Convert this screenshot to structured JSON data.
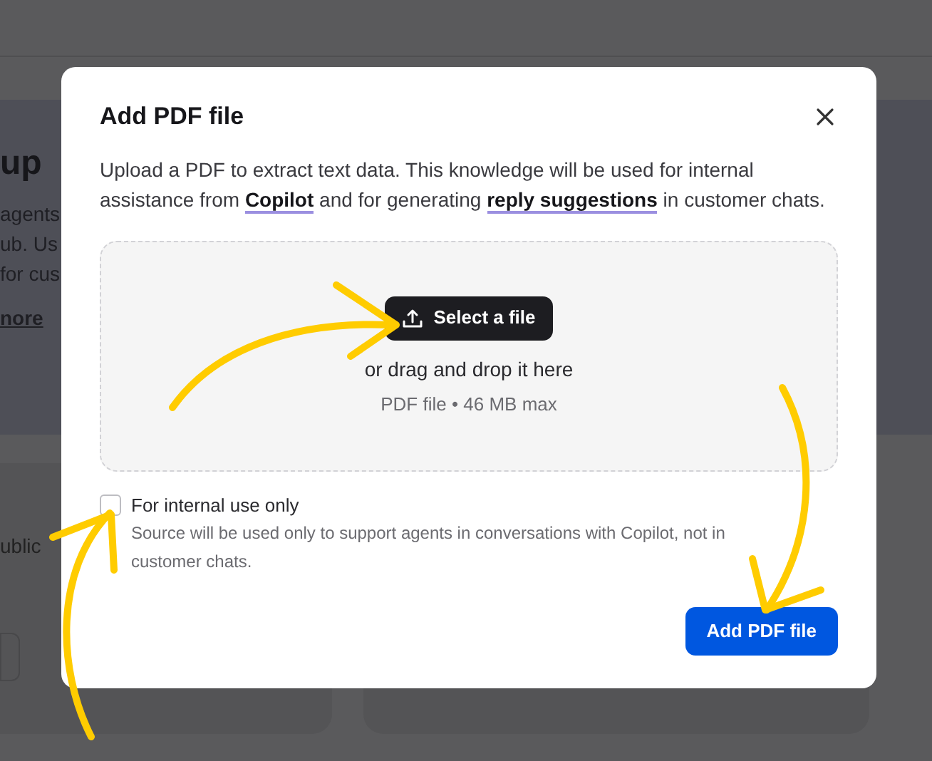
{
  "background": {
    "heading": "up",
    "lines": [
      "agents",
      "ub. Us",
      "for cus"
    ],
    "link": "nore",
    "card_text": "ublic"
  },
  "dialog": {
    "title": "Add PDF file",
    "description": [
      {
        "kind": "text",
        "text": "Upload a PDF to extract text data. This knowledge will be used for internal assistance from "
      },
      {
        "kind": "link",
        "text": "Copilot"
      },
      {
        "kind": "text",
        "text": " and for generating "
      },
      {
        "kind": "link",
        "text": "reply suggestions"
      },
      {
        "kind": "text",
        "text": " in customer chats."
      }
    ],
    "dropzone": {
      "button": "Select a file",
      "hint": "or drag and drop it here",
      "limits": "PDF file • 46 MB max"
    },
    "option": {
      "label": "For internal use only",
      "checked": false,
      "help": "Source will be used only to support agents in conversations with Copilot, not in customer chats."
    },
    "submit": "Add PDF file"
  }
}
